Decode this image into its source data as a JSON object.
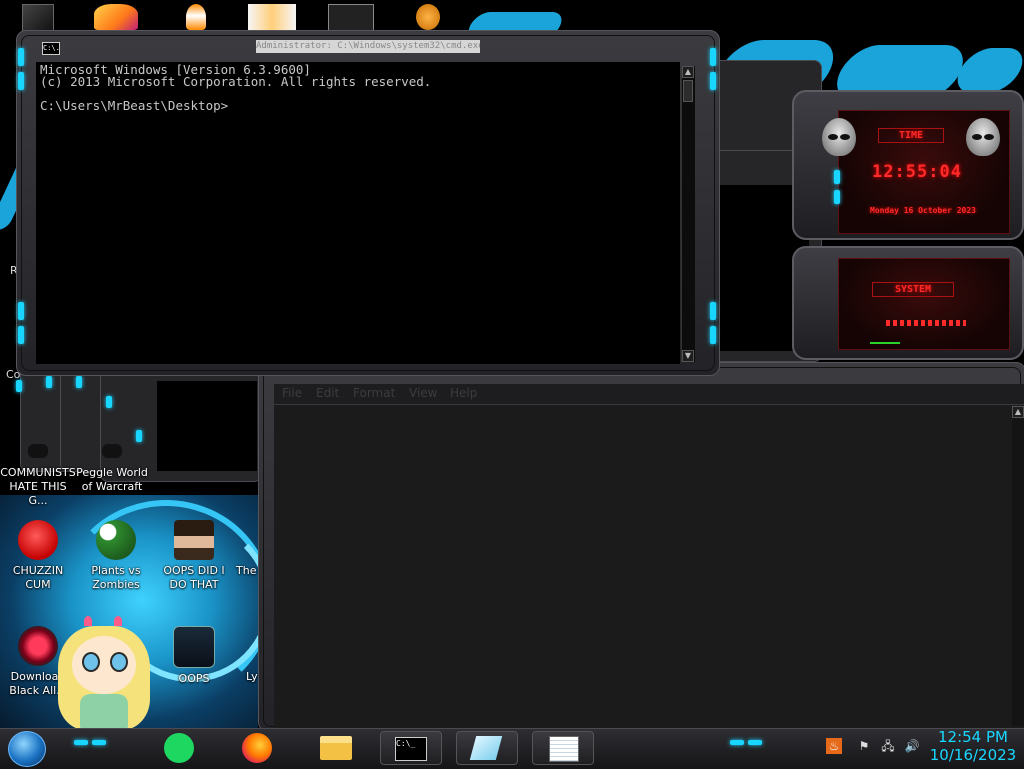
{
  "desktop": {
    "icons": [
      {
        "label": "COMMUNISTS HATE THIS G..."
      },
      {
        "label": "Peggle World of Warcraft"
      },
      {
        "label": "CHUZZIN CUM"
      },
      {
        "label": "Plants vs Zombies"
      },
      {
        "label": "OOPS DID I DO THAT"
      },
      {
        "label": "The"
      },
      {
        "label": "Download Black All..."
      },
      {
        "label": "OOPS"
      },
      {
        "label": "Ly"
      }
    ],
    "partial_labels": {
      "left_1": "Re",
      "left_2": "Co"
    }
  },
  "cmd": {
    "title": "Administrator: C:\\Windows\\system32\\cmd.exe",
    "icon_text": "C:\\.",
    "lines": [
      "Microsoft Windows [Version 6.3.9600]",
      "(c) 2013 Microsoft Corporation. All rights reserved.",
      "",
      "C:\\Users\\MrBeast\\Desktop>"
    ]
  },
  "notepad": {
    "menu": [
      "File",
      "Edit",
      "Format",
      "View",
      "Help"
    ]
  },
  "gadget": {
    "time_label": "TIME",
    "time": "12:55:04",
    "date": "Monday 16 October 2023",
    "system_label": "SYSTEM"
  },
  "taskbar": {
    "cmd_icon_text": "C:\\_",
    "clock_time": "12:54 PM",
    "clock_date": "10/16/2023"
  },
  "colors": {
    "accent": "#19d7ff",
    "gadget_red": "#ff2a2a",
    "wallpaper_blue": "#1aa4d9"
  }
}
